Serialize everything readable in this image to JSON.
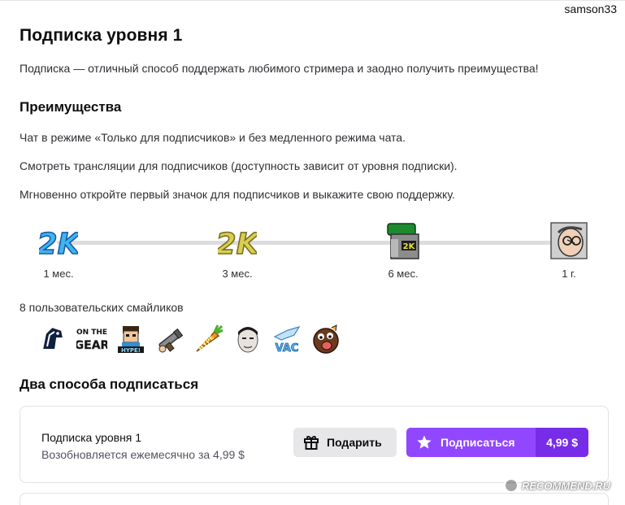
{
  "header": {
    "username": "samson33"
  },
  "page": {
    "title": "Подписка уровня 1",
    "intro": "Подписка — отличный способ поддержать любимого стримера и заодно получить преимущества!"
  },
  "benefits": {
    "heading": "Преимущества",
    "items": [
      "Чат в режиме «Только для подписчиков» и без медленного режима чата.",
      "Смотреть трансляции для подписчиков (доступность зависит от уровня подписки).",
      "Мгновенно откройте первый значок для подписчиков и выкажите свою поддержку."
    ]
  },
  "badges": [
    {
      "label": "1 мес.",
      "icon": "badge-2k-blue-icon"
    },
    {
      "label": "3 мес.",
      "icon": "badge-2k-gold-icon"
    },
    {
      "label": "6 мес.",
      "icon": "badge-green-can-icon"
    },
    {
      "label": "1 г.",
      "icon": "badge-face-icon"
    }
  ],
  "emotes": {
    "label": "8 пользовательских смайликов",
    "items": [
      "liquid-horse-emote-icon",
      "on-the-gear-emote-icon",
      "hype-emote-icon",
      "gun-emote-icon",
      "carrot-emote-icon",
      "face-emote-icon",
      "vac-emote-icon",
      "angry-ball-emote-icon"
    ]
  },
  "ways": {
    "heading": "Два способа подписаться",
    "card": {
      "title": "Подписка уровня 1",
      "subtitle": "Возобновляется ежемесячно за 4,99 $",
      "gift_label": "Подарить",
      "subscribe_label": "Подписаться",
      "price": "4,99 $"
    }
  },
  "watermark": "RECOMMEND.RU",
  "colors": {
    "accent": "#9147ff",
    "accent_dark": "#772ce8",
    "gift_bg": "#e7e7ea",
    "track": "#dcdcdf"
  }
}
